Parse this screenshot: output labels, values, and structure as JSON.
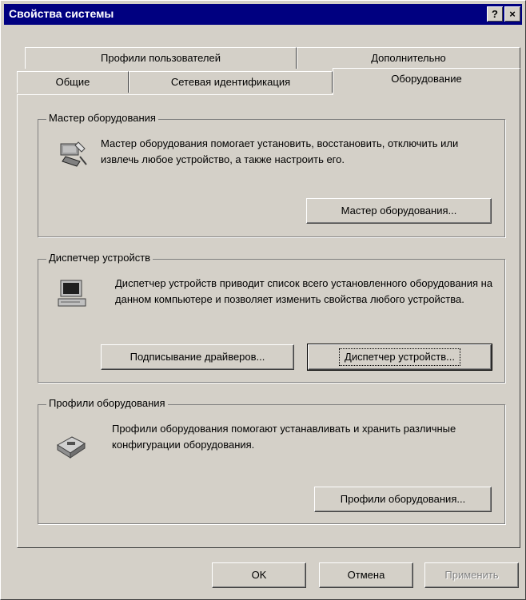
{
  "window": {
    "title": "Свойства системы",
    "help_label": "?",
    "close_label": "×"
  },
  "tabs": {
    "row_back": [
      "Профили пользователей",
      "Дополнительно"
    ],
    "row_front": [
      "Общие",
      "Сетевая идентификация",
      "Оборудование"
    ],
    "active": "Оборудование"
  },
  "hardware_wizard": {
    "title": "Мастер оборудования",
    "text": "Мастер оборудования помогает установить, восстановить, отключить или извлечь любое устройство, а также настроить его.",
    "button": "Мастер оборудования..."
  },
  "device_manager": {
    "title": "Диспетчер устройств",
    "text": "Диспетчер устройств приводит список всего установленного оборудования на данном компьютере и позволяет изменить свойства любого устройства.",
    "signing_button": "Подписывание драйверов...",
    "manager_button": "Диспетчер устройств..."
  },
  "hardware_profiles": {
    "title": "Профили оборудования",
    "text": "Профили оборудования помогают устанавливать и хранить различные конфигурации оборудования.",
    "button": "Профили оборудования..."
  },
  "footer": {
    "ok": "OK",
    "cancel": "Отмена",
    "apply": "Применить"
  }
}
